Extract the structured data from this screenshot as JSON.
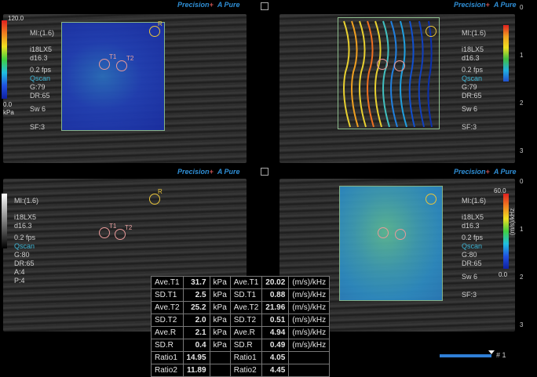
{
  "header": {
    "brand_precision": "Precision",
    "brand_apure": "A Pure",
    "plus": "+"
  },
  "q1": {
    "scale_top": "120.0",
    "scale_bottom": "0.0",
    "scale_unit": "kPa",
    "params": [
      "MI:(1.6)",
      "i18LX5",
      "d16.3",
      "0.2 fps"
    ],
    "qscan": "Qscan",
    "params2": [
      "G:79",
      "DR:65"
    ],
    "sw": "Sw 6",
    "sf": "SF:3",
    "roi": [
      "T1",
      "T2",
      "R"
    ]
  },
  "q2": {
    "params": [
      "MI:(1.6)",
      "i18LX5",
      "d16.3",
      "0.2 fps"
    ],
    "qscan": "Qscan",
    "params2": [
      "G:79",
      "DR:65"
    ],
    "sw": "Sw 6",
    "sf": "SF:3",
    "depth": [
      "0",
      "1",
      "2",
      "3"
    ]
  },
  "q3": {
    "params": [
      "MI:(1.6)",
      "i18LX5",
      "d16.3",
      "0.2 fps"
    ],
    "qscan": "Qscan",
    "params2": [
      "G:80",
      "DR:65",
      "A:4",
      "P:4"
    ],
    "roi": [
      "T1",
      "T2",
      "R"
    ]
  },
  "q4": {
    "scale_top": "60.0",
    "scale_bottom": "0.0",
    "scale_unit": "(m/s)/kHz",
    "params": [
      "MI:(1.6)",
      "i18LX5",
      "d16.3",
      "0.2 fps"
    ],
    "qscan": "Qscan",
    "params2": [
      "G:80",
      "DR:65"
    ],
    "sw": "Sw 6",
    "sf": "SF:3",
    "depth": [
      "0",
      "1",
      "2",
      "3"
    ]
  },
  "results": {
    "rows": [
      {
        "l1": "Ave.T1",
        "v1": "31.7",
        "u1": "kPa",
        "l2": "Ave.T1",
        "v2": "20.02",
        "u2": "(m/s)/kHz"
      },
      {
        "l1": "SD.T1",
        "v1": "2.5",
        "u1": "kPa",
        "l2": "SD.T1",
        "v2": "0.88",
        "u2": "(m/s)/kHz"
      },
      {
        "l1": "Ave.T2",
        "v1": "25.2",
        "u1": "kPa",
        "l2": "Ave.T2",
        "v2": "21.96",
        "u2": "(m/s)/kHz"
      },
      {
        "l1": "SD.T2",
        "v1": "2.0",
        "u1": "kPa",
        "l2": "SD.T2",
        "v2": "0.51",
        "u2": "(m/s)/kHz"
      },
      {
        "l1": "Ave.R",
        "v1": "2.1",
        "u1": "kPa",
        "l2": "Ave.R",
        "v2": "4.94",
        "u2": "(m/s)/kHz"
      },
      {
        "l1": "SD.R",
        "v1": "0.4",
        "u1": "kPa",
        "l2": "SD.R",
        "v2": "0.49",
        "u2": "(m/s)/kHz"
      },
      {
        "l1": "Ratio1",
        "v1": "14.95",
        "u1": "",
        "l2": "Ratio1",
        "v2": "4.05",
        "u2": ""
      },
      {
        "l1": "Ratio2",
        "v1": "11.89",
        "u1": "",
        "l2": "Ratio2",
        "v2": "4.45",
        "u2": ""
      }
    ]
  },
  "footer": {
    "page": "# 1"
  },
  "colors": {
    "roi_target": "#e89a9a",
    "roi_reference": "#e9c53b",
    "brand": "#2f8fd6",
    "progress": "#2f7fd6"
  }
}
